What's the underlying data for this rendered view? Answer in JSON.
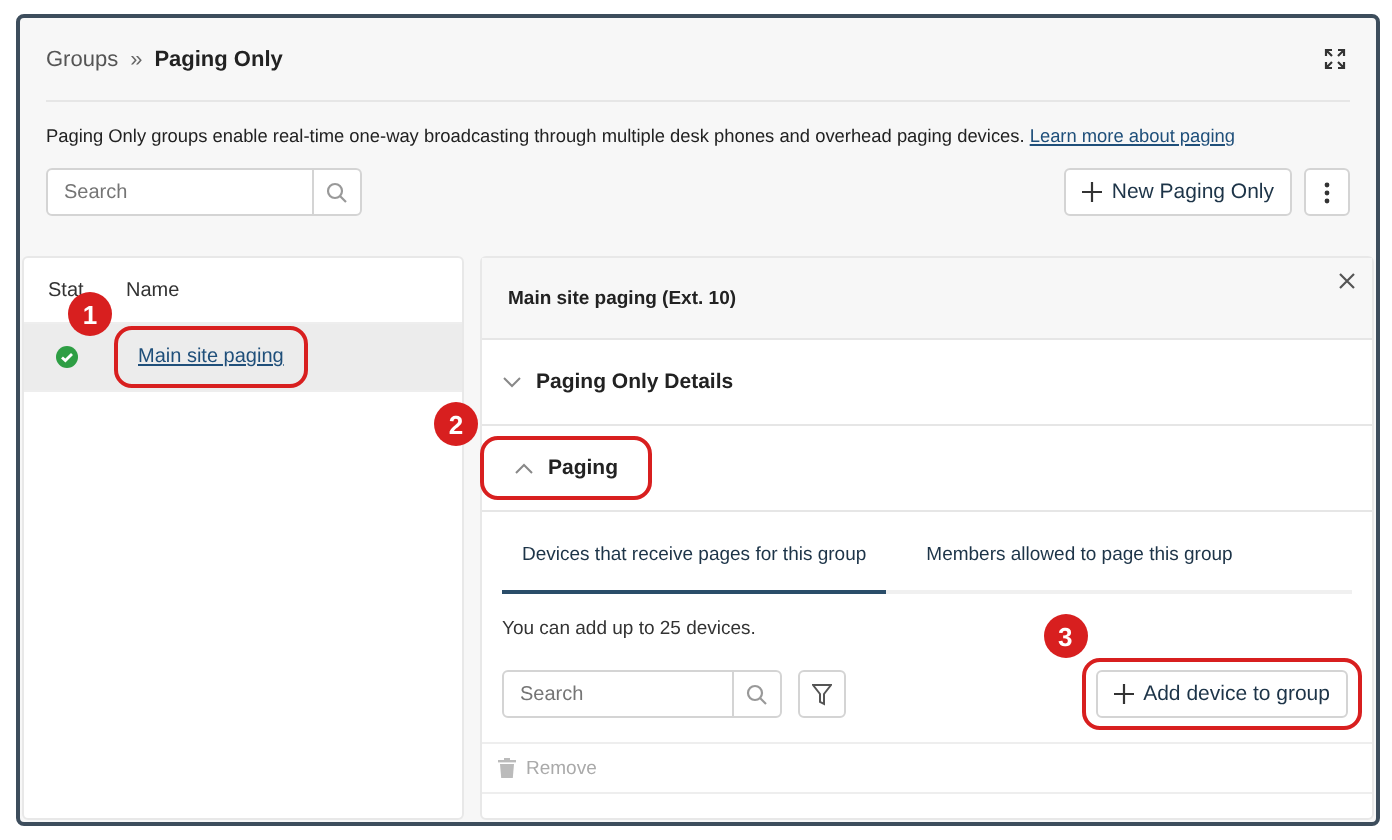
{
  "breadcrumb": {
    "parent": "Groups",
    "separator": "»",
    "current": "Paging Only"
  },
  "description": {
    "text": "Paging Only groups enable real-time one-way broadcasting through multiple desk phones and overhead paging devices.",
    "link": "Learn more about paging"
  },
  "search": {
    "placeholder": "Search"
  },
  "new_button": {
    "label": "New Paging Only"
  },
  "table": {
    "columns": [
      "Stat",
      "Name"
    ],
    "rows": [
      {
        "active": true,
        "name": "Main site paging",
        "selected": true,
        "annotation": "1"
      }
    ]
  },
  "detail": {
    "title": "Main site paging (Ext. 10)",
    "sections": [
      {
        "title": "Paging Only Details",
        "expanded": false
      },
      {
        "title": "Paging",
        "expanded": true,
        "annotation": "2"
      }
    ],
    "tabs": [
      {
        "label": "Devices that receive pages for this group",
        "selected": true
      },
      {
        "label": "Members allowed to page this group",
        "selected": false
      }
    ],
    "note": "You can add up to 25 devices.",
    "search": {
      "placeholder": "Search"
    },
    "add_button": {
      "label": "Add device to group",
      "annotation": "3"
    },
    "remove": {
      "label": "Remove",
      "disabled": true
    }
  }
}
